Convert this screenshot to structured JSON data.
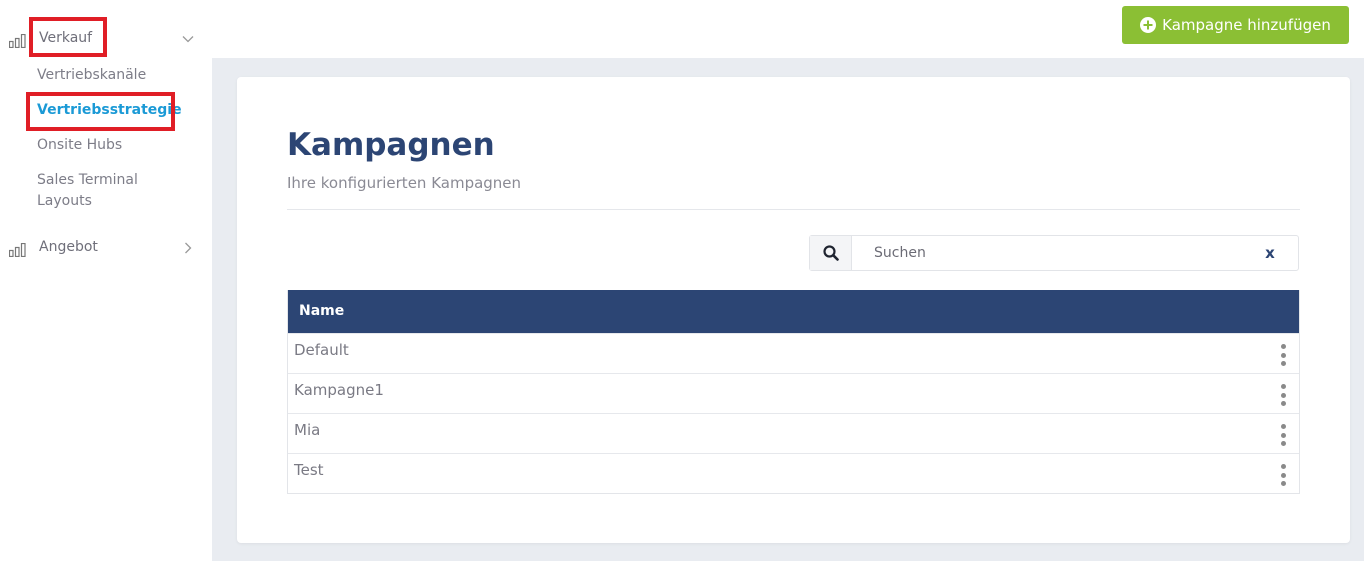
{
  "sidebar": {
    "groups": [
      {
        "label": "Verkauf",
        "icon": "bar-chart-icon",
        "expanded": true
      },
      {
        "label": "Angebot",
        "icon": "bar-chart-icon",
        "expanded": false
      }
    ],
    "subitems": [
      {
        "label": "Vertriebskanäle",
        "active": false
      },
      {
        "label": "Vertriebsstrategie",
        "active": true
      },
      {
        "label": "Onsite Hubs",
        "active": false
      },
      {
        "label": "Sales Terminal Layouts",
        "active": false
      }
    ]
  },
  "header": {
    "add_button_label": "Kampagne hinzufügen",
    "add_button_icon": "plus-circle-icon",
    "accent_color": "#8bbf34"
  },
  "main": {
    "title": "Kampagnen",
    "subtitle": "Ihre konfigurierten Kampagnen",
    "search": {
      "placeholder": "Suchen",
      "value": "",
      "clear_label": "x"
    },
    "table": {
      "column_header": "Name",
      "header_color": "#2c4574",
      "rows": [
        "Default",
        "Kampagne1",
        "Mia",
        "Test"
      ]
    }
  },
  "annotations": {
    "highlight_color": "#e01e26"
  }
}
